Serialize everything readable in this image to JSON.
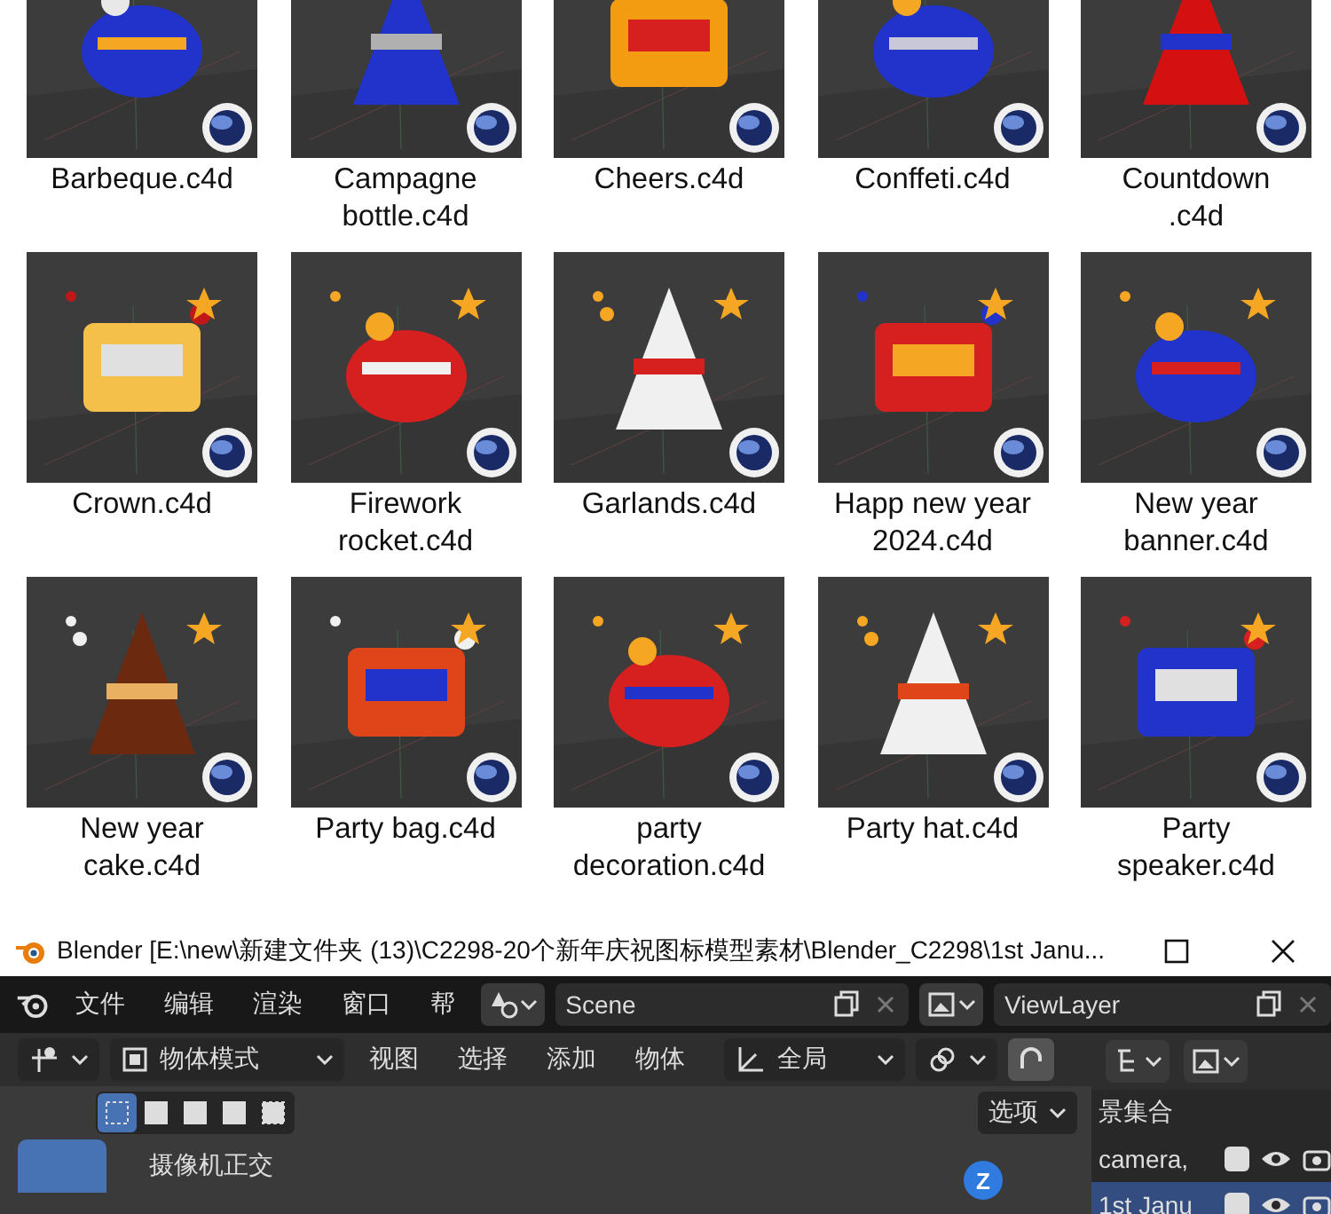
{
  "files": [
    {
      "lines": [
        "Barbeque.c4d"
      ]
    },
    {
      "lines": [
        "Campagne",
        "bottle.c4d"
      ]
    },
    {
      "lines": [
        "Cheers.c4d"
      ]
    },
    {
      "lines": [
        "Conffeti.c4d"
      ]
    },
    {
      "lines": [
        "Countdown",
        ".c4d"
      ]
    },
    {
      "lines": [
        "Crown.c4d"
      ]
    },
    {
      "lines": [
        "Firework",
        "rocket.c4d"
      ]
    },
    {
      "lines": [
        "Garlands.c4d"
      ]
    },
    {
      "lines": [
        "Happ new year",
        "2024.c4d"
      ]
    },
    {
      "lines": [
        "New year",
        "banner.c4d"
      ]
    },
    {
      "lines": [
        "New year",
        "cake.c4d"
      ]
    },
    {
      "lines": [
        "Party bag.c4d"
      ]
    },
    {
      "lines": [
        "party",
        "decoration.c4d"
      ]
    },
    {
      "lines": [
        "Party hat.c4d"
      ]
    },
    {
      "lines": [
        "Party",
        "speaker.c4d"
      ]
    }
  ],
  "blender": {
    "window": {
      "title": "Blender [E:\\new\\新建文件夹 (13)\\C2298-20个新年庆祝图标模型素材\\Blender_C2298\\1st Janu..."
    },
    "menu": [
      "文件",
      "编辑",
      "渲染",
      "窗口",
      "帮"
    ],
    "scene": "Scene",
    "view_layer": "ViewLayer",
    "mode": "物体模式",
    "viewport_menu": [
      "视图",
      "选择",
      "添加",
      "物体"
    ],
    "orientation": "全局",
    "select_modes": [
      {
        "selected": true
      },
      {
        "selected": false
      },
      {
        "selected": false
      },
      {
        "selected": false
      },
      {
        "selected": false
      }
    ],
    "options": "选项",
    "view_label": "摄像机正交",
    "gizmo_axis": "Z",
    "outliner": {
      "header": "景集合",
      "rows": [
        {
          "name": "camera,",
          "checked": true,
          "selected": false
        },
        {
          "name": "1st Janu",
          "checked": true,
          "selected": true
        }
      ]
    }
  }
}
